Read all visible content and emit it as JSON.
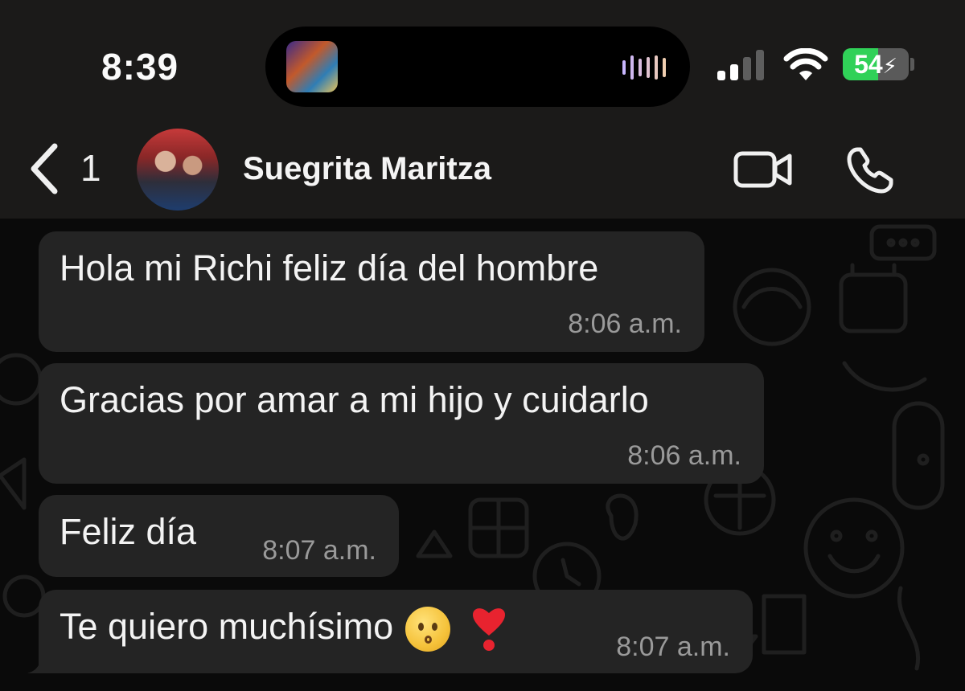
{
  "status_bar": {
    "time": "8:39",
    "battery": "54",
    "battery_level_percent": 54,
    "icons": [
      "now-playing-thumbnail",
      "audio-waveform-icon",
      "cellular-signal-icon",
      "wifi-icon",
      "battery-charging-icon"
    ]
  },
  "header": {
    "back_count": "1",
    "contact_name": "Suegrita Maritza",
    "icons": [
      "back-chevron-icon",
      "avatar",
      "video-call-icon",
      "phone-call-icon"
    ]
  },
  "messages": [
    {
      "text": "Hola mi Richi feliz día del hombre",
      "time": "8:06",
      "ampm": "a.m."
    },
    {
      "text": "Gracias por amar a mi hijo y cuidarlo",
      "time": "8:06",
      "ampm": "a.m."
    },
    {
      "text": "Feliz día",
      "time": "8:07",
      "ampm": "a.m."
    },
    {
      "text": "Te quiero muchísimo",
      "time": "8:07",
      "ampm": "a.m.",
      "emojis": [
        "kissing-face-emoji",
        "red-exclamation-emoji"
      ]
    }
  ],
  "colors": {
    "bar_bg": "#1b1a19",
    "bubble_bg": "#242424",
    "battery_green": "#30d158",
    "time_text": "#9a9a9a"
  }
}
